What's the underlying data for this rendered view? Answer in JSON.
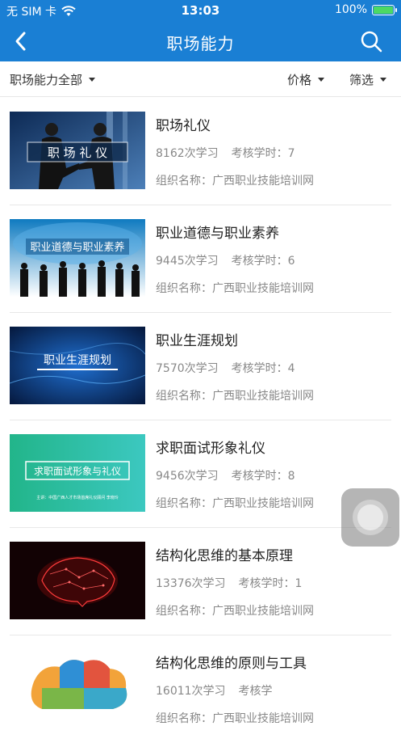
{
  "status": {
    "carrier": "无 SIM 卡",
    "time": "13:03",
    "battery": "100%",
    "battery_level": 1.0
  },
  "nav": {
    "title": "职场能力"
  },
  "filters": {
    "category": "职场能力全部",
    "price": "价格",
    "filter": "筛选"
  },
  "courses": [
    {
      "title": "职场礼仪",
      "views": "8162次学习",
      "hours": "考核学时：7",
      "org": "组织名称：广西职业技能培训网",
      "thumb_text": "职 场 礼 仪",
      "thumb_theme": "handshake"
    },
    {
      "title": "职业道德与职业素养",
      "views": "9445次学习",
      "hours": "考核学时：6",
      "org": "组织名称：广西职业技能培训网",
      "thumb_text": "职业道德与职业素养",
      "thumb_theme": "people"
    },
    {
      "title": "职业生涯规划",
      "views": "7570次学习",
      "hours": "考核学时：4",
      "org": "组织名称：广西职业技能培训网",
      "thumb_text": "职业生涯规划",
      "thumb_theme": "blue"
    },
    {
      "title": "求职面试形象礼仪",
      "views": "9456次学习",
      "hours": "考核学时：8",
      "org": "组织名称：广西职业技能培训网",
      "thumb_text": "求职面试形象与礼仪",
      "thumb_sub": "主讲：中国广西人才市场首席礼仪顾问    李晓玲",
      "thumb_theme": "green"
    },
    {
      "title": "结构化思维的基本原理",
      "views": "13376次学习",
      "hours": "考核学时：1",
      "org": "组织名称：广西职业技能培训网",
      "thumb_theme": "brain"
    },
    {
      "title": "结构化思维的原则与工具",
      "views": "16011次学习",
      "hours": "考核学",
      "org": "组织名称：广西职业技能培训网",
      "thumb_theme": "colorbrain"
    }
  ],
  "colors": {
    "primary": "#1a7fd4"
  }
}
